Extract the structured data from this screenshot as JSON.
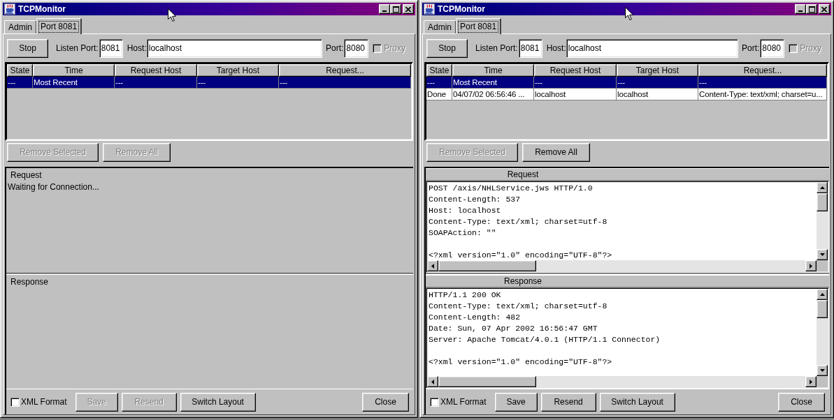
{
  "windows": [
    {
      "title": "TCPMonitor",
      "tabs": [
        {
          "label": "Admin",
          "selected": false
        },
        {
          "label": "Port 8081",
          "selected": true
        }
      ],
      "toolbar": {
        "stop_button": "Stop",
        "listen_port": {
          "label": "Listen Port:",
          "value": "8081"
        },
        "host": {
          "label": "Host:",
          "value": "localhost"
        },
        "port": {
          "label": "Port:",
          "value": "8080"
        },
        "proxy": {
          "label": "Proxy",
          "checked": false,
          "disabled": true
        }
      },
      "table": {
        "columns": [
          "State",
          "Time",
          "Request Host",
          "Target Host",
          "Request..."
        ],
        "rows": [
          {
            "cells": [
              "---",
              "Most Recent",
              "---",
              "---",
              "---"
            ],
            "selected": true
          }
        ]
      },
      "table_buttons": [
        {
          "label": "Remove Selected",
          "disabled": true
        },
        {
          "label": "Remove All",
          "disabled": true
        }
      ],
      "request": {
        "kind": "status",
        "label": "Request",
        "text": "Waiting for Connection..."
      },
      "response": {
        "kind": "status",
        "label": "Response"
      },
      "footer": {
        "xml_format": {
          "label": "XML Format",
          "checked": false
        },
        "buttons": [
          {
            "label": "Save",
            "disabled": true
          },
          {
            "label": "Resend",
            "disabled": true
          },
          {
            "label": "Switch Layout",
            "disabled": false
          }
        ],
        "close_button": "Close"
      }
    },
    {
      "title": "TCPMonitor",
      "tabs": [
        {
          "label": "Admin",
          "selected": false
        },
        {
          "label": "Port 8081",
          "selected": true
        }
      ],
      "toolbar": {
        "stop_button": "Stop",
        "listen_port": {
          "label": "Listen Port:",
          "value": "8081"
        },
        "host": {
          "label": "Host:",
          "value": "localhost"
        },
        "port": {
          "label": "Port:",
          "value": "8080"
        },
        "proxy": {
          "label": "Proxy",
          "checked": false,
          "disabled": true
        }
      },
      "table": {
        "columns": [
          "State",
          "Time",
          "Request Host",
          "Target Host",
          "Request..."
        ],
        "rows": [
          {
            "cells": [
              "---",
              "Most Recent",
              "---",
              "---",
              "---"
            ],
            "selected": true
          },
          {
            "cells": [
              "Done",
              "04/07/02 06:56:46 ...",
              "localhost",
              "localhost",
              "Content-Type: text/xml; charset=u..."
            ],
            "selected": false
          }
        ]
      },
      "table_buttons": [
        {
          "label": "Remove Selected",
          "disabled": true
        },
        {
          "label": "Remove All",
          "disabled": false
        }
      ],
      "request": {
        "kind": "text",
        "label": "Request",
        "headers": [
          "POST /axis/NHLService.jws HTTP/1.0",
          "Content-Length: 537",
          "Host: localhost",
          "Content-Type: text/xml; charset=utf-8",
          "SOAPAction: \"\""
        ],
        "body": [
          "<?xml version=\"1.0\" encoding=\"UTF-8\"?>"
        ]
      },
      "response": {
        "kind": "text",
        "label": "Response",
        "headers": [
          "HTTP/1.1 200 OK",
          "Content-Type: text/xml; charset=utf-8",
          "Content-Length: 482",
          "Date: Sun, 07 Apr 2002 16:56:47 GMT",
          "Server: Apache Tomcat/4.0.1 (HTTP/1.1 Connector)"
        ],
        "body": [
          "<?xml version=\"1.0\" encoding=\"UTF-8\"?>"
        ]
      },
      "footer": {
        "xml_format": {
          "label": "XML Format",
          "checked": false
        },
        "buttons": [
          {
            "label": "Save",
            "disabled": false
          },
          {
            "label": "Resend",
            "disabled": false
          },
          {
            "label": "Switch Layout",
            "disabled": false
          }
        ],
        "close_button": "Close"
      }
    }
  ]
}
